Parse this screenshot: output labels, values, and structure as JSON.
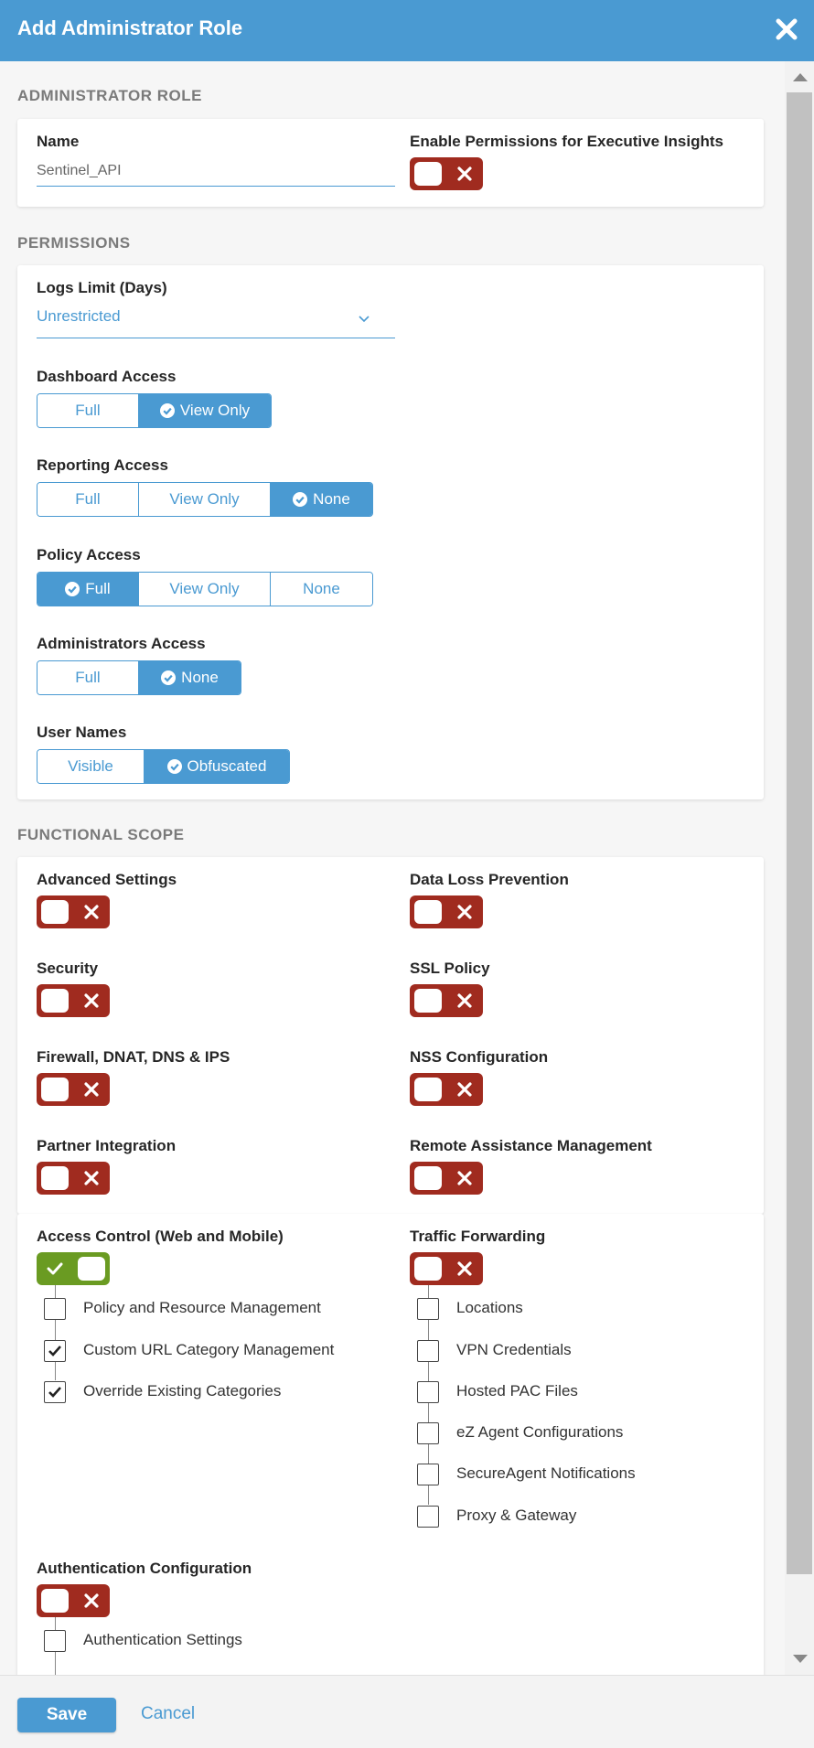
{
  "header": {
    "title": "Add Administrator Role"
  },
  "admin_role": {
    "section_title": "ADMINISTRATOR ROLE",
    "name_label": "Name",
    "name_value": "Sentinel_API",
    "exec_insights_label": "Enable Permissions for Executive Insights",
    "exec_insights_enabled": false
  },
  "permissions": {
    "section_title": "PERMISSIONS",
    "logs_limit_label": "Logs Limit (Days)",
    "logs_limit_value": "Unrestricted",
    "dashboard": {
      "label": "Dashboard Access",
      "options": [
        "Full",
        "View Only"
      ],
      "selected": "View Only"
    },
    "reporting": {
      "label": "Reporting Access",
      "options": [
        "Full",
        "View Only",
        "None"
      ],
      "selected": "None"
    },
    "policy": {
      "label": "Policy Access",
      "options": [
        "Full",
        "View Only",
        "None"
      ],
      "selected": "Full"
    },
    "administrators": {
      "label": "Administrators Access",
      "options": [
        "Full",
        "None"
      ],
      "selected": "None"
    },
    "user_names": {
      "label": "User Names",
      "options": [
        "Visible",
        "Obfuscated"
      ],
      "selected": "Obfuscated"
    }
  },
  "functional_scope": {
    "section_title": "FUNCTIONAL SCOPE",
    "toggles": [
      {
        "label": "Advanced Settings",
        "enabled": false
      },
      {
        "label": "Data Loss Prevention",
        "enabled": false
      },
      {
        "label": "Security",
        "enabled": false
      },
      {
        "label": "SSL Policy",
        "enabled": false
      },
      {
        "label": "Firewall, DNAT, DNS & IPS",
        "enabled": false
      },
      {
        "label": "NSS Configuration",
        "enabled": false
      },
      {
        "label": "Partner Integration",
        "enabled": false
      },
      {
        "label": "Remote Assistance Management",
        "enabled": false
      }
    ],
    "access_control": {
      "label": "Access Control (Web and Mobile)",
      "enabled": true,
      "items": [
        {
          "label": "Policy and Resource Management",
          "checked": false
        },
        {
          "label": "Custom URL Category Management",
          "checked": true
        },
        {
          "label": "Override Existing Categories",
          "checked": true
        }
      ]
    },
    "traffic_forwarding": {
      "label": "Traffic Forwarding",
      "enabled": false,
      "items": [
        {
          "label": "Locations",
          "checked": false
        },
        {
          "label": "VPN Credentials",
          "checked": false
        },
        {
          "label": "Hosted PAC Files",
          "checked": false
        },
        {
          "label": "eZ Agent Configurations",
          "checked": false
        },
        {
          "label": "SecureAgent Notifications",
          "checked": false
        },
        {
          "label": "Proxy & Gateway",
          "checked": false
        }
      ]
    },
    "authentication": {
      "label": "Authentication Configuration",
      "enabled": false,
      "items": [
        {
          "label": "Authentication Settings",
          "checked": false
        }
      ]
    }
  },
  "footer": {
    "save_label": "Save",
    "cancel_label": "Cancel"
  },
  "colors": {
    "header": "#4a9ad2",
    "accent": "#4a9ad2",
    "toggle_off": "#a02b1f",
    "toggle_on": "#6a9b22"
  }
}
